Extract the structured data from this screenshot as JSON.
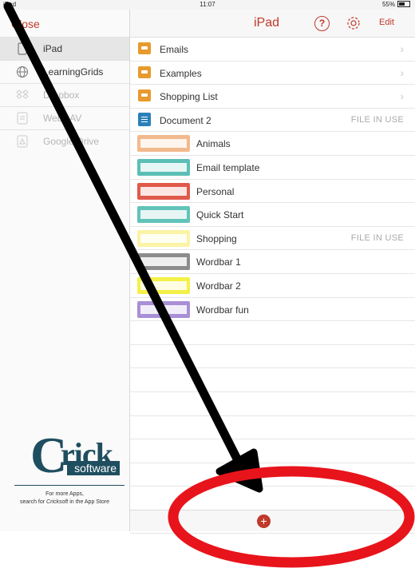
{
  "status": {
    "device": "iPad",
    "time": "11:07",
    "battery": "55%"
  },
  "sidebar": {
    "close_label": "Close",
    "items": [
      {
        "label": "iPad",
        "icon": "ipad-icon"
      },
      {
        "label": "LearningGrids",
        "icon": "globe-icon"
      },
      {
        "label": "Dropbox",
        "icon": "dropbox-icon"
      },
      {
        "label": "WebDAV",
        "icon": "webdav-icon"
      },
      {
        "label": "Google Drive",
        "icon": "google-drive-icon"
      }
    ]
  },
  "nav": {
    "title": "iPad",
    "help": "?",
    "edit": "Edit"
  },
  "rows": [
    {
      "label": "Emails",
      "kind": "folder",
      "accessory": "›"
    },
    {
      "label": "Examples",
      "kind": "folder",
      "accessory": "›"
    },
    {
      "label": "Shopping List",
      "kind": "folder",
      "accessory": "›"
    },
    {
      "label": "Document 2",
      "kind": "document",
      "status": "FILE IN USE"
    },
    {
      "label": "Animals",
      "kind": "grid",
      "color": "#f2b98e"
    },
    {
      "label": "Email template",
      "kind": "grid",
      "color": "#5bbfb5"
    },
    {
      "label": "Personal",
      "kind": "grid",
      "color": "#e05a4a"
    },
    {
      "label": "Quick Start",
      "kind": "grid",
      "color": "#62c3b8"
    },
    {
      "label": "Shopping",
      "kind": "grid",
      "color": "#fbf3a6",
      "status": "FILE IN USE"
    },
    {
      "label": "Wordbar 1",
      "kind": "grid",
      "color": "#8c8c8c"
    },
    {
      "label": "Wordbar 2",
      "kind": "grid",
      "color": "#f4f048"
    },
    {
      "label": "Wordbar fun",
      "kind": "grid",
      "color": "#a98fd6"
    }
  ],
  "toolbar": {
    "add": "+"
  },
  "branding": {
    "logo_c": "C",
    "logo_rick": "rick",
    "logo_software": "software",
    "note_line1": "For more Apps,",
    "note_line2_pre": "search for ",
    "note_line2_em": "Cricksoft",
    "note_line2_post": " in the App Store"
  },
  "colors": {
    "accent": "#c0392b",
    "brand": "#1f4e5f",
    "annotation_arrow": "#000000",
    "annotation_circle": "#e8141b"
  }
}
